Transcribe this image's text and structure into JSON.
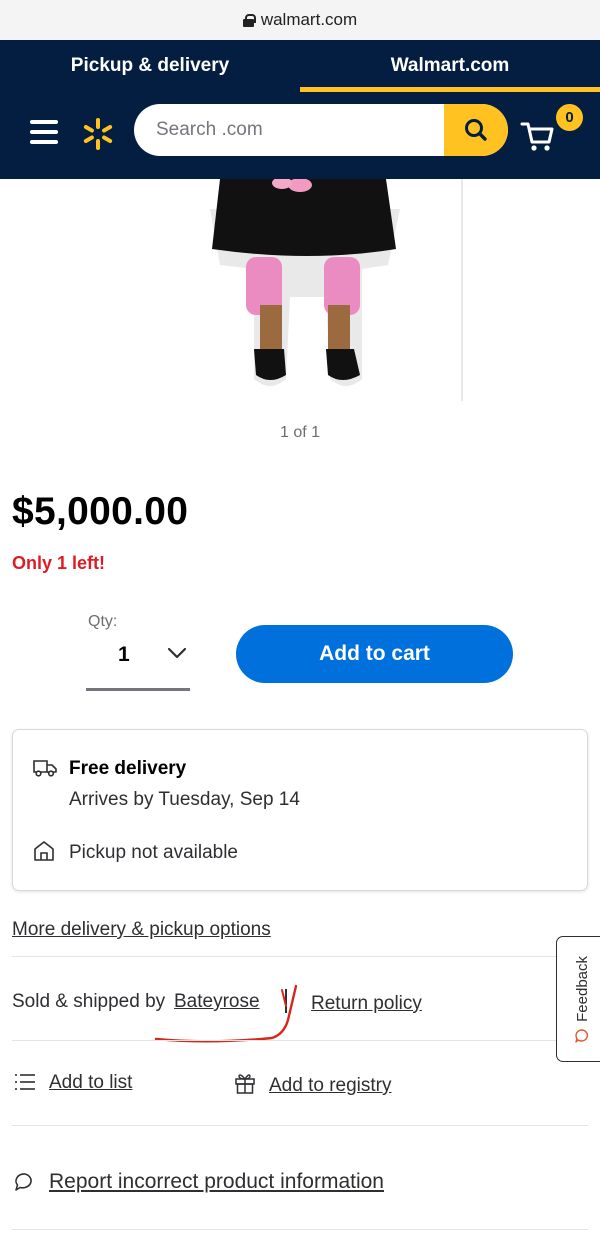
{
  "browser": {
    "url": "walmart.com"
  },
  "header": {
    "tabs": [
      {
        "label": "Pickup & delivery",
        "active": false
      },
      {
        "label": "Walmart.com",
        "active": true
      }
    ],
    "search": {
      "placeholder": "Search .com"
    },
    "cart": {
      "count": "0"
    },
    "colors": {
      "navy": "#041e42",
      "yellow": "#ffc220",
      "blue": "#0071dc"
    }
  },
  "product": {
    "image_counter": "1 of 1",
    "price": "$5,000.00",
    "stock": "Only 1 left!"
  },
  "purchase": {
    "qty_label": "Qty:",
    "qty_value": "1",
    "add_to_cart": "Add to cart"
  },
  "delivery": {
    "free_delivery": "Free delivery",
    "arrives": "Arrives by Tuesday, Sep 14",
    "pickup": "Pickup not available",
    "more_options": "More delivery & pickup options"
  },
  "seller": {
    "sold_by_label": "Sold & shipped by",
    "seller_name": "Bateyrose",
    "return_policy": "Return policy"
  },
  "feedback": {
    "label": "Feedback"
  },
  "actions": {
    "add_to_list": "Add to list",
    "add_to_registry": "Add to registry",
    "report": "Report incorrect product information"
  }
}
